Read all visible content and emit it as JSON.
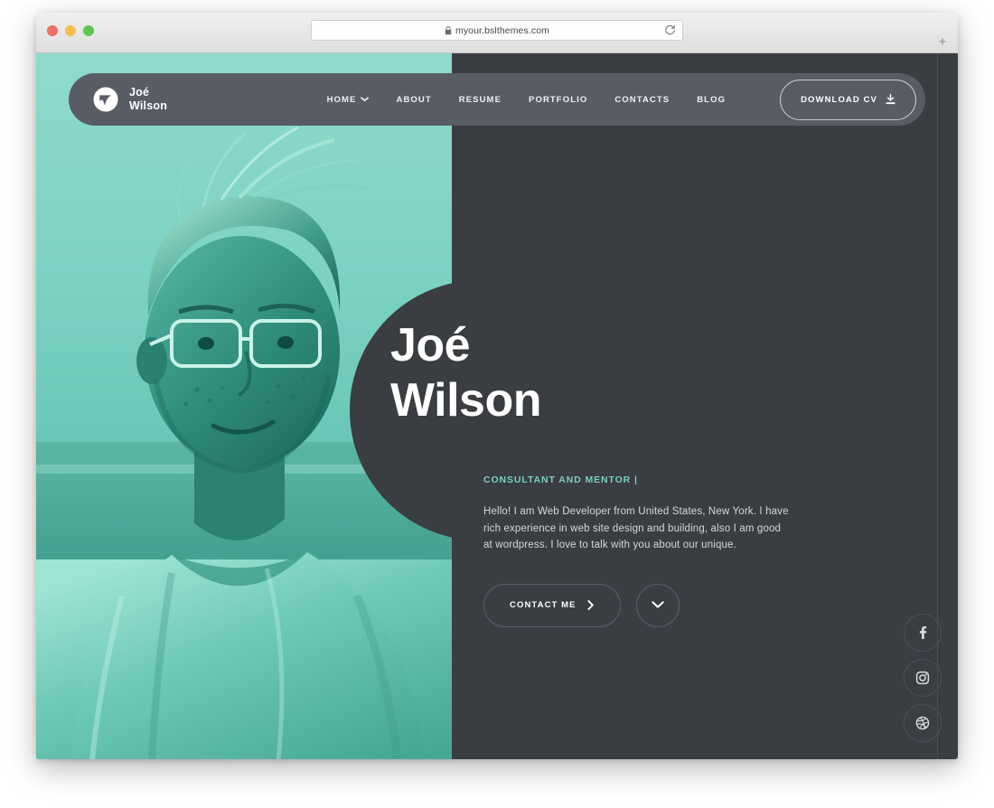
{
  "browser": {
    "url": "myour.bslthemes.com",
    "lock_icon": "lock-icon",
    "reload_icon": "reload-icon",
    "new_tab_label": "+",
    "traffic_lights": [
      "close-red",
      "minimize-yellow",
      "zoom-green"
    ]
  },
  "colors": {
    "accent_teal": "#79cfc0",
    "photo_teal": "#64c5b4",
    "page_dark": "#3a3d42",
    "navbar_gray": "#585c65",
    "text_light": "#d6d8db"
  },
  "navbar": {
    "logo_icon": "brand-swoosh-logo-icon",
    "brand_name": "Joé\nWilson",
    "links": [
      {
        "label": "HOME",
        "has_dropdown": true,
        "icon": "chevron-down-icon"
      },
      {
        "label": "ABOUT",
        "has_dropdown": false
      },
      {
        "label": "RESUME",
        "has_dropdown": false
      },
      {
        "label": "PORTFOLIO",
        "has_dropdown": false
      },
      {
        "label": "CONTACTS",
        "has_dropdown": false
      },
      {
        "label": "BLOG",
        "has_dropdown": false
      }
    ],
    "cv_button": {
      "label": "DOWNLOAD CV",
      "icon": "download-icon"
    }
  },
  "hero": {
    "name": "Joé\nWilson",
    "subtitle": "CONSULTANT AND MENTOR |",
    "description": "Hello! I am Web Developer from United States, New York. I have rich experience in web site design and building, also I am good at wordpress. I love to talk with you about our unique.",
    "contact_button": {
      "label": "CONTACT ME",
      "icon": "chevron-right-icon"
    },
    "scroll_button": {
      "icon": "chevron-down-icon"
    },
    "photo_alt": "portrait-photo-teal-duotone"
  },
  "social": [
    {
      "name": "facebook",
      "icon": "facebook-icon"
    },
    {
      "name": "instagram",
      "icon": "instagram-icon"
    },
    {
      "name": "dribbble",
      "icon": "dribbble-icon"
    }
  ]
}
